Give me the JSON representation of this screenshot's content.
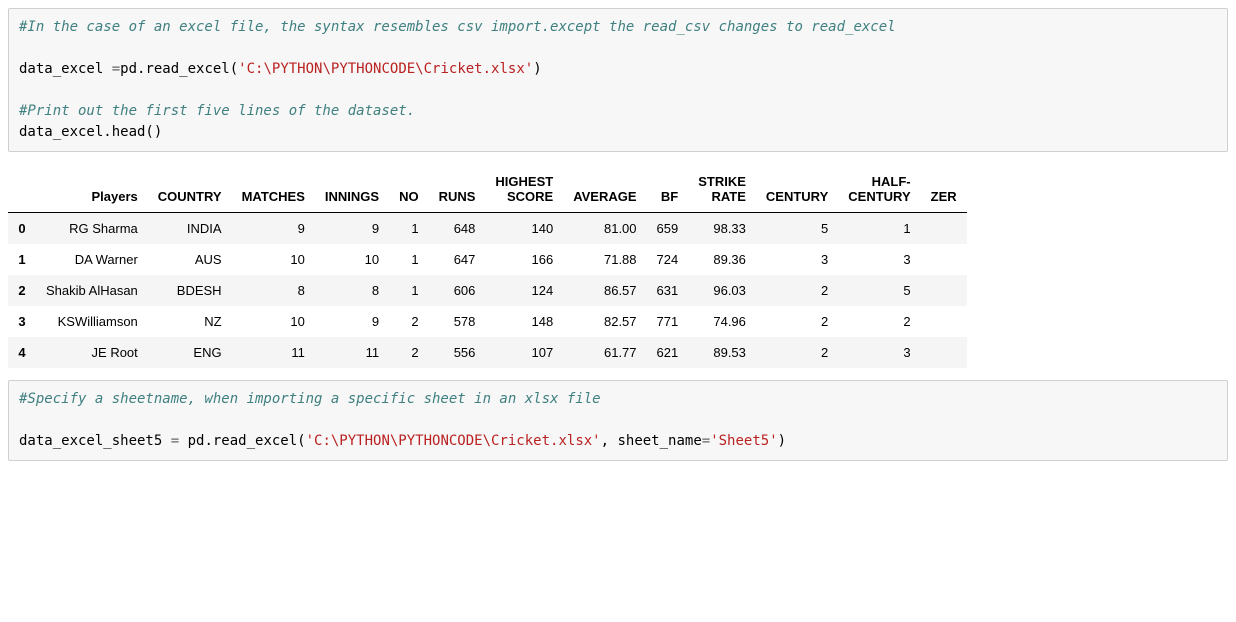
{
  "cell1": {
    "comment1": "#In the case of an excel file, the syntax resembles csv import.except the read_csv changes to read_excel",
    "line2_lhs": "data_excel ",
    "line2_eq": "=",
    "line2_rhs1": "pd.read_excel(",
    "line2_str": "'C:\\PYTHON\\PYTHONCODE\\Cricket.xlsx'",
    "line2_rhs2": ")",
    "comment2": "#Print out the first five lines of the dataset.",
    "line4": "data_excel.head()"
  },
  "table": {
    "headers": [
      "Players",
      "COUNTRY",
      "MATCHES",
      "INNINGS",
      "NO",
      "RUNS",
      "HIGHEST SCORE",
      "AVERAGE",
      "BF",
      "STRIKE RATE",
      "CENTURY",
      "HALF-CENTURY",
      "ZER"
    ],
    "rows": [
      {
        "idx": "0",
        "Players": "RG Sharma",
        "COUNTRY": "INDIA",
        "MATCHES": "9",
        "INNINGS": "9",
        "NO": "1",
        "RUNS": "648",
        "HIGHEST SCORE": "140",
        "AVERAGE": "81.00",
        "BF": "659",
        "STRIKE RATE": "98.33",
        "CENTURY": "5",
        "HALF-CENTURY": "1",
        "ZER": ""
      },
      {
        "idx": "1",
        "Players": "DA Warner",
        "COUNTRY": "AUS",
        "MATCHES": "10",
        "INNINGS": "10",
        "NO": "1",
        "RUNS": "647",
        "HIGHEST SCORE": "166",
        "AVERAGE": "71.88",
        "BF": "724",
        "STRIKE RATE": "89.36",
        "CENTURY": "3",
        "HALF-CENTURY": "3",
        "ZER": ""
      },
      {
        "idx": "2",
        "Players": "Shakib Al Hasan",
        "COUNTRY": "BDESH",
        "MATCHES": "8",
        "INNINGS": "8",
        "NO": "1",
        "RUNS": "606",
        "HIGHEST SCORE": "124",
        "AVERAGE": "86.57",
        "BF": "631",
        "STRIKE RATE": "96.03",
        "CENTURY": "2",
        "HALF-CENTURY": "5",
        "ZER": ""
      },
      {
        "idx": "3",
        "Players": "KS Williamson",
        "COUNTRY": "NZ",
        "MATCHES": "10",
        "INNINGS": "9",
        "NO": "2",
        "RUNS": "578",
        "HIGHEST SCORE": "148",
        "AVERAGE": "82.57",
        "BF": "771",
        "STRIKE RATE": "74.96",
        "CENTURY": "2",
        "HALF-CENTURY": "2",
        "ZER": ""
      },
      {
        "idx": "4",
        "Players": "JE Root",
        "COUNTRY": "ENG",
        "MATCHES": "11",
        "INNINGS": "11",
        "NO": "2",
        "RUNS": "556",
        "HIGHEST SCORE": "107",
        "AVERAGE": "61.77",
        "BF": "621",
        "STRIKE RATE": "89.53",
        "CENTURY": "2",
        "HALF-CENTURY": "3",
        "ZER": ""
      }
    ]
  },
  "cell2": {
    "comment1": "#Specify a sheetname, when importing a specific sheet in an xlsx file",
    "line2_lhs": "data_excel_sheet5 ",
    "line2_eq": "=",
    "line2_rhs1": " pd.read_excel(",
    "line2_str1": "'C:\\PYTHON\\PYTHONCODE\\Cricket.xlsx'",
    "line2_mid": ", sheet_name",
    "line2_eq2": "=",
    "line2_str2": "'Sheet5'",
    "line2_rhs2": ")"
  }
}
